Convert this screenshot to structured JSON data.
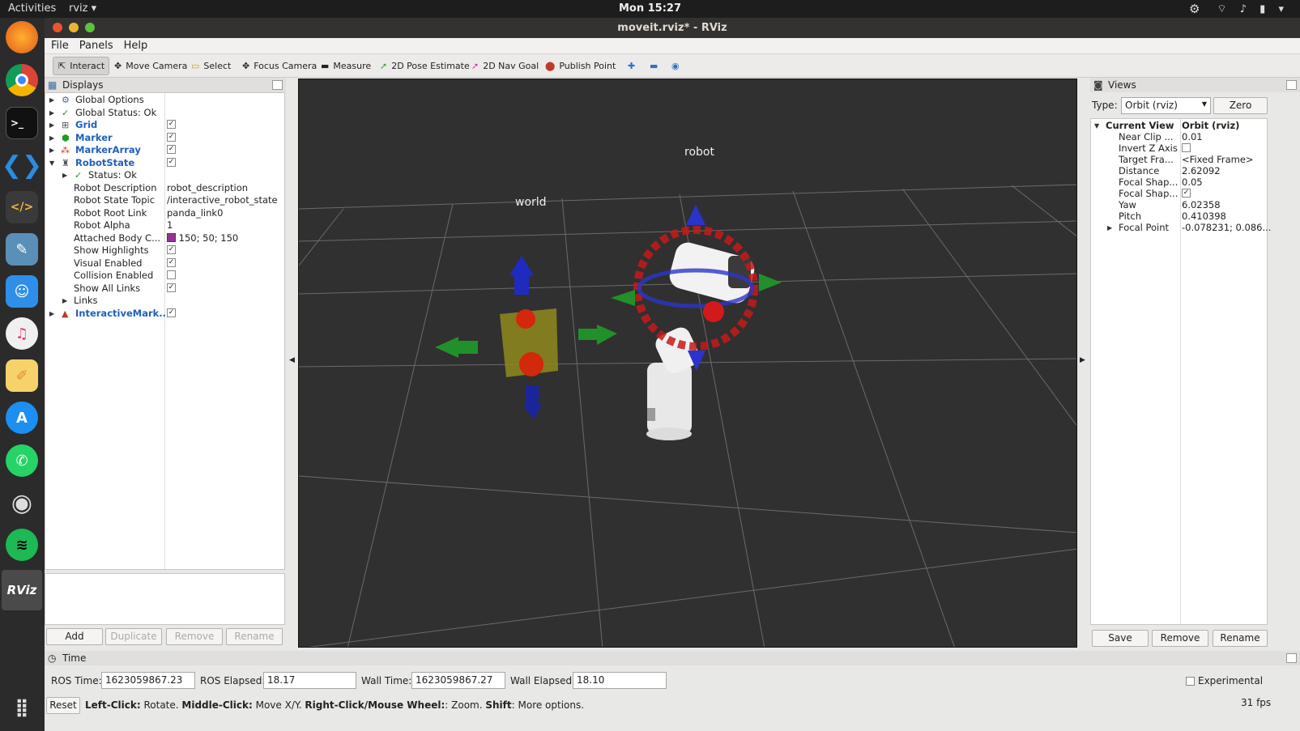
{
  "system": {
    "activities": "Activities",
    "app_menu": "rviz ▾",
    "clock": "Mon 15:27",
    "tray": "⌔ ♪ ▮ ▾"
  },
  "window": {
    "title": "moveit.rviz* - RViz"
  },
  "menu": [
    "File",
    "Panels",
    "Help"
  ],
  "toolbar": {
    "interact": "Interact",
    "move_camera": "Move Camera",
    "select": "Select",
    "focus_camera": "Focus Camera",
    "measure": "Measure",
    "pose_estimate": "2D Pose Estimate",
    "nav_goal": "2D Nav Goal",
    "publish_point": "Publish Point"
  },
  "displays": {
    "title": "Displays",
    "rows": [
      {
        "label": "Global Options"
      },
      {
        "label": "Global Status: Ok"
      },
      {
        "label": "Grid",
        "checked": true
      },
      {
        "label": "Marker",
        "checked": true
      },
      {
        "label": "MarkerArray",
        "checked": true
      },
      {
        "label": "RobotState",
        "checked": true
      },
      {
        "label": "Status: Ok"
      },
      {
        "label": "Robot Description",
        "value": "robot_description"
      },
      {
        "label": "Robot State Topic",
        "value": "/interactive_robot_state"
      },
      {
        "label": "Robot Root Link",
        "value": "panda_link0"
      },
      {
        "label": "Robot Alpha",
        "value": "1"
      },
      {
        "label": "Attached Body C...",
        "value": "150; 50; 150",
        "swatch": "#963296"
      },
      {
        "label": "Show Highlights",
        "checked": true
      },
      {
        "label": "Visual Enabled",
        "checked": true
      },
      {
        "label": "Collision Enabled",
        "checked": false
      },
      {
        "label": "Show All Links",
        "checked": true
      },
      {
        "label": "Links"
      },
      {
        "label": "InteractiveMark...",
        "checked": true
      }
    ],
    "buttons": {
      "add": "Add",
      "duplicate": "Duplicate",
      "remove": "Remove",
      "rename": "Rename"
    }
  },
  "viewport": {
    "label_robot": "robot",
    "label_world": "world"
  },
  "views": {
    "title": "Views",
    "type_label": "Type:",
    "type_value": "Orbit (rviz)",
    "zero": "Zero",
    "current_view": "Current View",
    "current_value": "Orbit (rviz)",
    "props": [
      {
        "label": "Near Clip ...",
        "value": "0.01"
      },
      {
        "label": "Invert Z Axis",
        "checked": false
      },
      {
        "label": "Target Fra...",
        "value": "<Fixed Frame>"
      },
      {
        "label": "Distance",
        "value": "2.62092"
      },
      {
        "label": "Focal Shap...",
        "value": "0.05"
      },
      {
        "label": "Focal Shap...",
        "checked": true
      },
      {
        "label": "Yaw",
        "value": "6.02358"
      },
      {
        "label": "Pitch",
        "value": "0.410398"
      },
      {
        "label": "Focal Point",
        "value": "-0.078231; 0.086..."
      }
    ],
    "buttons": {
      "save": "Save",
      "remove": "Remove",
      "rename": "Rename"
    }
  },
  "time": {
    "title": "Time",
    "ros_time_label": "ROS Time:",
    "ros_time": "1623059867.23",
    "ros_elapsed_label": "ROS Elapsed:",
    "ros_elapsed": "18.17",
    "wall_time_label": "Wall Time:",
    "wall_time": "1623059867.27",
    "wall_elapsed_label": "Wall Elapsed:",
    "wall_elapsed": "18.10",
    "experimental": "Experimental"
  },
  "status": {
    "reset": "Reset",
    "h1": "Left-Click:",
    "t1": " Rotate. ",
    "h2": "Middle-Click:",
    "t2": " Move X/Y. ",
    "h3": "Right-Click/Mouse Wheel:",
    "t3": ": Zoom. ",
    "h4": "Shift",
    "t4": ": More options.",
    "fps": "31 fps"
  }
}
